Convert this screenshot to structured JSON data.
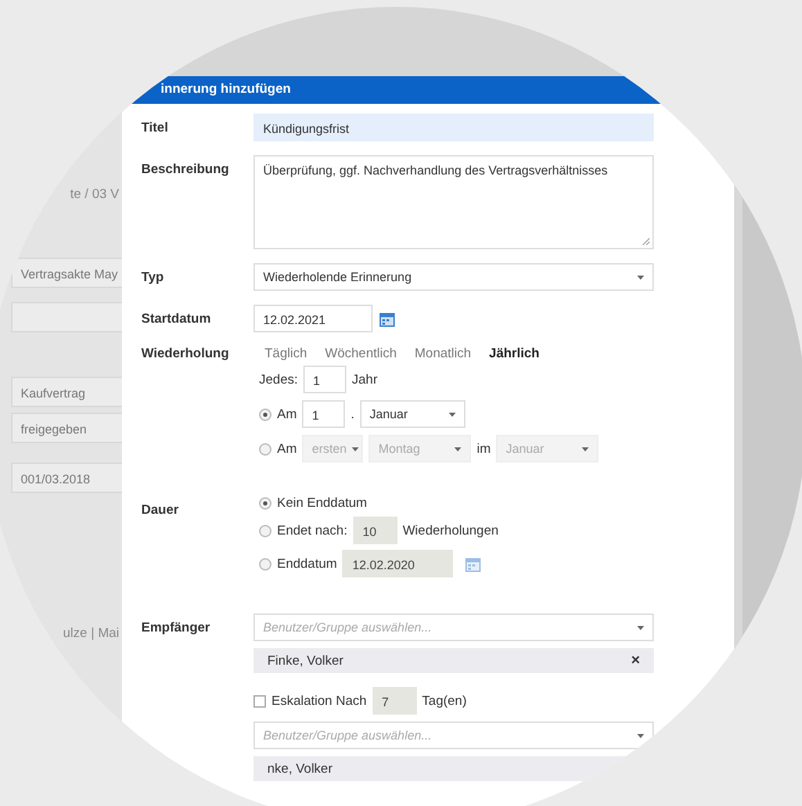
{
  "background_form": {
    "path_fragment": "te / 03 V",
    "fields": [
      "Vertragsakte May",
      "Kaufvertrag",
      "freigegeben",
      "001/03.2018"
    ],
    "people_fragment": "ulze | Mai"
  },
  "dialog": {
    "title": "innerung hinzufügen",
    "title_field": {
      "label": "Titel",
      "value": "Kündigungsfrist"
    },
    "description": {
      "label": "Beschreibung",
      "value": "Überprüfung, ggf. Nachverhandlung des Vertragsverhältnisses"
    },
    "type": {
      "label": "Typ",
      "value": "Wiederholende Erinnerung"
    },
    "start_date": {
      "label": "Startdatum",
      "value": "12.02.2021"
    },
    "repeat": {
      "label": "Wiederholung",
      "tabs": [
        {
          "label": "Täglich",
          "selected": false
        },
        {
          "label": "Wöchentlich",
          "selected": false
        },
        {
          "label": "Monatlich",
          "selected": false
        },
        {
          "label": "Jährlich",
          "selected": true
        }
      ],
      "every": {
        "label": "Jedes:",
        "value": "1",
        "unit": "Jahr"
      },
      "options": [
        {
          "kind": "date",
          "selected": true,
          "label": "Am",
          "day": "1",
          "separator": ".",
          "month": "Januar"
        },
        {
          "kind": "weekday",
          "selected": false,
          "label": "Am",
          "ordinal": "ersten",
          "weekday": "Montag",
          "connector": "im",
          "month": "Januar"
        }
      ]
    },
    "duration": {
      "label": "Dauer",
      "options": [
        {
          "kind": "none",
          "selected": true,
          "label": "Kein Enddatum"
        },
        {
          "kind": "count",
          "selected": false,
          "label": "Endet nach:",
          "value": "10",
          "unit": "Wiederholungen"
        },
        {
          "kind": "date",
          "selected": false,
          "label": "Enddatum",
          "value": "12.02.2020"
        }
      ]
    },
    "recipients": {
      "label": "Empfänger",
      "placeholder": "Benutzer/Gruppe auswählen...",
      "chips": [
        {
          "label": "Finke, Volker",
          "remove": "×"
        }
      ]
    },
    "escalation": {
      "checked": false,
      "label": "Eskalation Nach",
      "value": "7",
      "unit": "Tag(en)",
      "placeholder": "Benutzer/Gruppe auswählen...",
      "chips": [
        "nke, Volker"
      ]
    }
  }
}
